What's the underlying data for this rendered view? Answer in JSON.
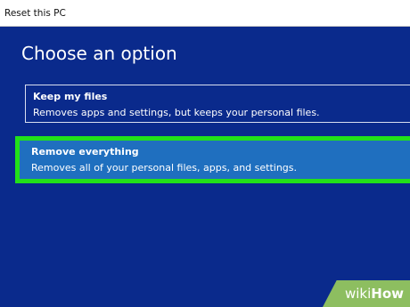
{
  "window": {
    "title": "Reset this PC"
  },
  "main": {
    "heading": "Choose an option",
    "options": [
      {
        "title": "Keep my files",
        "description": "Removes apps and settings, but keeps your personal files."
      },
      {
        "title": "Remove everything",
        "description": "Removes all of your personal files, apps, and settings."
      }
    ]
  },
  "colors": {
    "background": "#0a2a8c",
    "selected_option": "#1f6fbf",
    "highlight_outline": "#22e01a",
    "watermark": "#8dbe60"
  },
  "watermark": {
    "part1": "wiki",
    "part2": "How"
  }
}
